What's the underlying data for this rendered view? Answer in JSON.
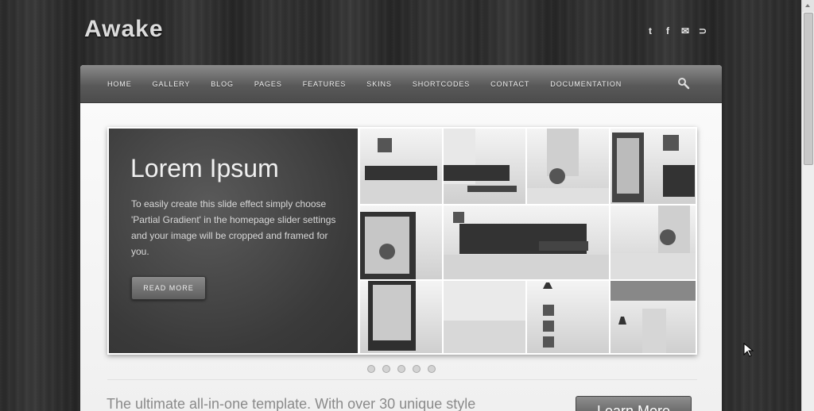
{
  "site": {
    "logo": "Awake"
  },
  "social": {
    "icons": [
      {
        "name": "twitter-icon",
        "glyph": "t"
      },
      {
        "name": "facebook-icon",
        "glyph": "f"
      },
      {
        "name": "email-icon",
        "glyph": "✉"
      },
      {
        "name": "rss-icon",
        "glyph": "⊃"
      }
    ]
  },
  "nav": {
    "items": [
      "HOME",
      "GALLERY",
      "BLOG",
      "PAGES",
      "FEATURES",
      "SKINS",
      "SHORTCODES",
      "CONTACT",
      "DOCUMENTATION"
    ],
    "search_icon": "search-icon"
  },
  "slide": {
    "title": "Lorem Ipsum",
    "body": "To easily create this slide effect simply choose 'Partial Gradient' in the homepage slider settings and your image will be cropped and framed for you.",
    "button": "READ MORE"
  },
  "pagination": {
    "count": 5
  },
  "intro": {
    "tagline": "The ultimate all-in-one template. With over 30 unique style",
    "button": "Learn More"
  }
}
